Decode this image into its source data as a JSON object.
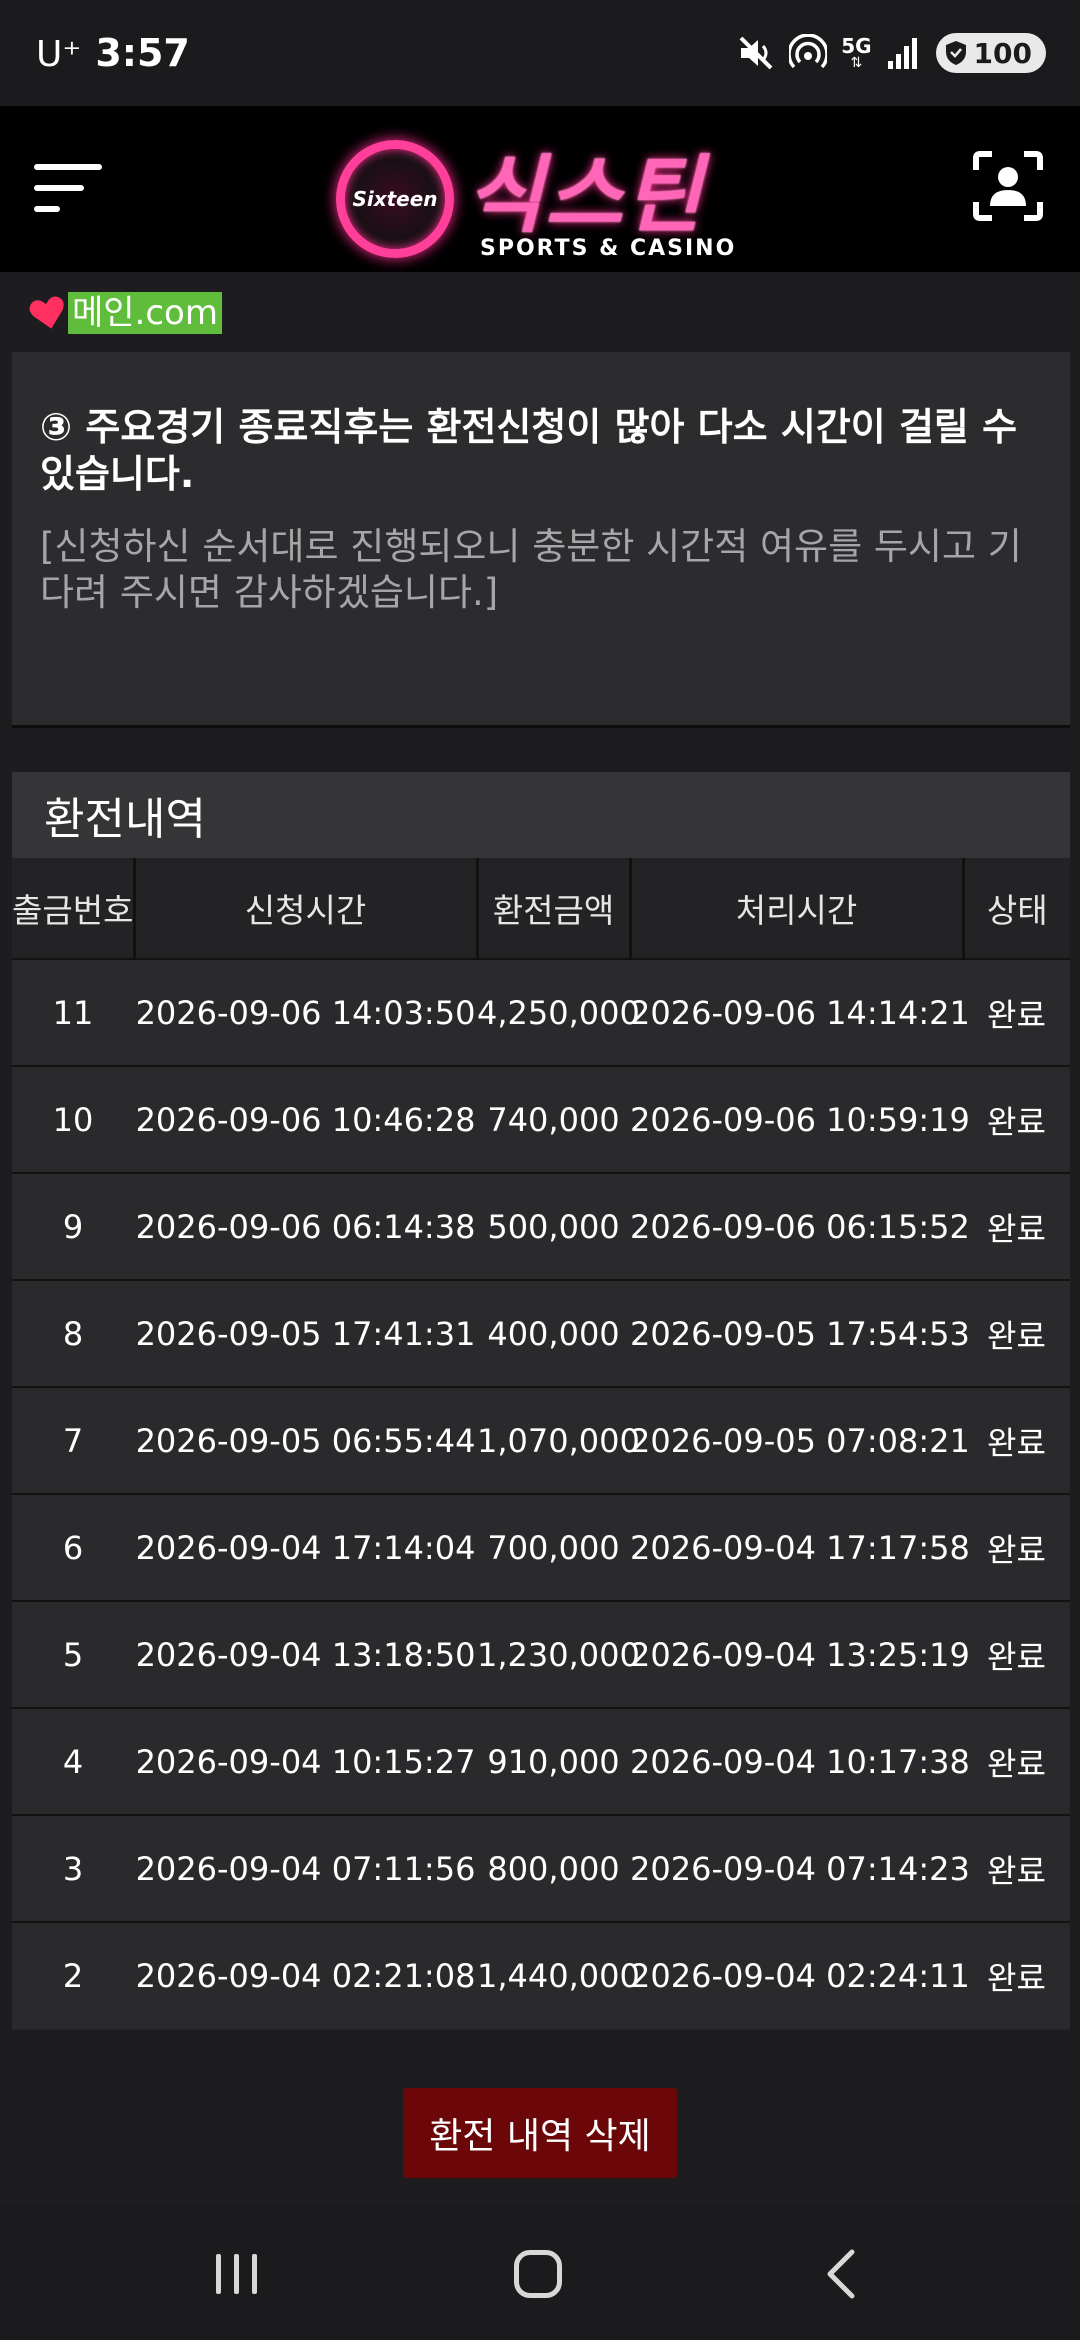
{
  "status_bar": {
    "carrier": "U⁺",
    "time": "3:57",
    "network": "5G",
    "battery": "100"
  },
  "header": {
    "logo_badge": "Sixteen",
    "logo_title": "식스틴",
    "logo_subtitle": "SPORTS & CASINO"
  },
  "domain_badge": "메인.com",
  "notice": {
    "main": "③ 주요경기 종료직후는 환전신청이 많아 다소 시간이 걸릴 수 있습니다.",
    "sub": "[신청하신 순서대로 진행되오니 충분한 시간적 여유를 두시고 기다려 주시면 감사하겠습니다.]"
  },
  "history": {
    "title": "환전내역",
    "columns": [
      "출금번호",
      "신청시간",
      "환전금액",
      "처리시간",
      "상태"
    ],
    "rows": [
      [
        "11",
        "2026-09-06 14:03:50",
        "4,250,000",
        "2026-09-06 14:14:21",
        "완료"
      ],
      [
        "10",
        "2026-09-06 10:46:28",
        "740,000",
        "2026-09-06 10:59:19",
        "완료"
      ],
      [
        "9",
        "2026-09-06 06:14:38",
        "500,000",
        "2026-09-06 06:15:52",
        "완료"
      ],
      [
        "8",
        "2026-09-05 17:41:31",
        "400,000",
        "2026-09-05 17:54:53",
        "완료"
      ],
      [
        "7",
        "2026-09-05 06:55:44",
        "1,070,000",
        "2026-09-05 07:08:21",
        "완료"
      ],
      [
        "6",
        "2026-09-04 17:14:04",
        "700,000",
        "2026-09-04 17:17:58",
        "완료"
      ],
      [
        "5",
        "2026-09-04 13:18:50",
        "1,230,000",
        "2026-09-04 13:25:19",
        "완료"
      ],
      [
        "4",
        "2026-09-04 10:15:27",
        "910,000",
        "2026-09-04 10:17:38",
        "완료"
      ],
      [
        "3",
        "2026-09-04 07:11:56",
        "800,000",
        "2026-09-04 07:14:23",
        "완료"
      ],
      [
        "2",
        "2026-09-04 02:21:08",
        "1,440,000",
        "2026-09-04 02:24:11",
        "완료"
      ]
    ],
    "delete_label": "환전 내역 삭제"
  },
  "colors": {
    "background": "#1d1d1f",
    "brand_pink": "#ff3f9a",
    "delete_button": "#6b0709",
    "domain_badge": "#5fbd3b"
  },
  "icons": [
    "mute-icon",
    "hotspot-icon",
    "5g-icon",
    "signal-icon",
    "shield-icon",
    "menu-icon",
    "profile-scan-icon",
    "heart-icon",
    "recent-apps-icon",
    "home-icon",
    "back-icon"
  ]
}
